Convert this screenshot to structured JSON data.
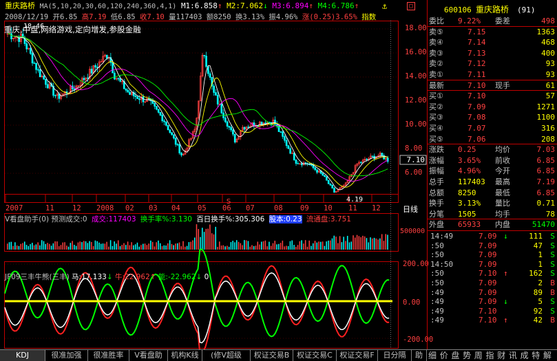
{
  "header": {
    "stock_name": "重庆路桥",
    "ma_label": "MA(5,10,20,30,60,120,240,360,4,1)",
    "m1": "M1:6.858",
    "m1_arrow": "↑",
    "m2": "M2:7.062",
    "m2_arrow": "↓",
    "m3": "M3:6.894",
    "m3_arrow": "↑",
    "m4": "M4:6.786",
    "m4_arrow": "↑",
    "date": "2008/12/19",
    "open": "开6.85",
    "high": "高7.19",
    "low": "低6.85",
    "close": "收7.10",
    "volume": "量117403",
    "amount": "额8250",
    "turnover": "换3.13%",
    "amplitude": "振4.96%",
    "change": "涨(0.25)3.65%",
    "index_btn": "指数",
    "subtitle": "重庆,中盘,网络游戏,定向增发,参股金融",
    "peak_label": "18.46",
    "low_label": "4.19",
    "price_tag": "7.10"
  },
  "main_chart": {
    "y_ticks": [
      "18.00",
      "16.00",
      "14.00",
      "12.00",
      "10.00",
      "8.00",
      "6.00"
    ],
    "x_ticks": [
      "2007",
      "11",
      "12",
      "2008",
      "02",
      "03",
      "04",
      "05",
      "06",
      "07",
      "08",
      "09",
      "10",
      "11",
      "12"
    ],
    "period": "日线"
  },
  "volume_panel": {
    "title": "V看盘助手(0) 预测成交:0",
    "vol_label": "成交:117403",
    "turn_label": "换手率%:3.130",
    "hundred_label": "百日换手%:305.306",
    "gauge_label": "股本:0.23",
    "float_label": "流通盘:3.751",
    "y_tick": "500000"
  },
  "indicator_panel": {
    "title": "JF09三丰牛熊(三丰)",
    "horse": "马:17.133",
    "horse_arrow": "↓",
    "ox": "牛:22.962",
    "ox_arrow": "↑",
    "energy": "能:-22.962",
    "energy_arrow": "↓",
    "zero_marker": "0",
    "y_ticks": [
      "200.00",
      "0.00",
      "-200.00"
    ]
  },
  "quote": {
    "code": "600106",
    "name": "重庆路桥",
    "suffix": "(91)",
    "weibi_label": "委比",
    "weibi": "9.22%",
    "weicha_label": "委差",
    "weicha": "498",
    "asks": [
      {
        "label": "卖⑤",
        "price": "7.15",
        "vol": "1363"
      },
      {
        "label": "卖④",
        "price": "7.14",
        "vol": "468"
      },
      {
        "label": "卖③",
        "price": "7.13",
        "vol": "400"
      },
      {
        "label": "卖②",
        "price": "7.12",
        "vol": "93"
      },
      {
        "label": "卖①",
        "price": "7.11",
        "vol": "93"
      }
    ],
    "latest_label": "最新",
    "latest": "7.10",
    "hand_label": "现手",
    "hand": "61",
    "bids": [
      {
        "label": "买①",
        "price": "7.10",
        "vol": "57"
      },
      {
        "label": "买②",
        "price": "7.09",
        "vol": "1271"
      },
      {
        "label": "买③",
        "price": "7.08",
        "vol": "1100"
      },
      {
        "label": "买④",
        "price": "7.07",
        "vol": "316"
      },
      {
        "label": "买⑤",
        "price": "7.06",
        "vol": "208"
      }
    ],
    "stats": [
      {
        "l1": "涨跌",
        "v1": "0.25",
        "l2": "均价",
        "v2": "7.03"
      },
      {
        "l1": "涨幅",
        "v1": "3.65%",
        "l2": "前收",
        "v2": "6.85"
      },
      {
        "l1": "振幅",
        "v1": "4.96%",
        "l2": "今开",
        "v2": "6.85"
      },
      {
        "l1": "总手",
        "v1": "117403",
        "l2": "最高",
        "v2": "7.19"
      },
      {
        "l1": "总额",
        "v1": "8250",
        "l2": "最低",
        "v2": "6.85"
      },
      {
        "l1": "换手",
        "v1": "3.13%",
        "l2": "量比",
        "v2": "0.71"
      },
      {
        "l1": "分笔",
        "v1": "1505",
        "l2": "均手",
        "v2": "78"
      }
    ],
    "outer_label": "外盘",
    "outer": "65933",
    "inner_label": "内盘",
    "inner": "51470",
    "ticks": [
      {
        "time": "14:49",
        "price": "7.09",
        "arrow": "↓",
        "vol": "111",
        "side": "S"
      },
      {
        "time": ":50",
        "price": "7.09",
        "arrow": "",
        "vol": "47",
        "side": "S"
      },
      {
        "time": ":50",
        "price": "7.09",
        "arrow": "",
        "vol": "1",
        "side": "S"
      },
      {
        "time": "14:50",
        "price": "7.09",
        "arrow": "",
        "vol": "1",
        "side": "S"
      },
      {
        "time": ":50",
        "price": "7.10",
        "arrow": "↑",
        "vol": "162",
        "side": "S"
      },
      {
        "time": ":50",
        "price": "7.09",
        "arrow": "",
        "vol": "2",
        "side": "B"
      },
      {
        "time": ":49",
        "price": "7.09",
        "arrow": "",
        "vol": "89",
        "side": "B"
      },
      {
        "time": ":49",
        "price": "7.09",
        "arrow": "↓",
        "vol": "5",
        "side": "S"
      },
      {
        "time": ":49",
        "price": "7.10",
        "arrow": "",
        "vol": "92",
        "side": "S"
      },
      {
        "time": ":49",
        "price": "7.10",
        "arrow": "↑",
        "vol": "42",
        "side": "B"
      }
    ]
  },
  "tabs": [
    "KDJ",
    "很准加强",
    "很准胜率",
    "V看盘助手",
    "机构K线",
    "(修V超级MACD",
    "权证交易B",
    "权证交易C",
    "权证交易F",
    "日分隔线",
    "助"
  ],
  "right_tabs": [
    "细",
    "价",
    "盘",
    "势",
    "周",
    "指",
    "财",
    "讯",
    "成",
    "特",
    "解"
  ],
  "colors": {
    "up": "#ff4040",
    "down": "#00ffff",
    "yellow": "#ffff00",
    "green": "#00ff00",
    "magenta": "#ff00ff",
    "panel_red": "#c00000"
  }
}
